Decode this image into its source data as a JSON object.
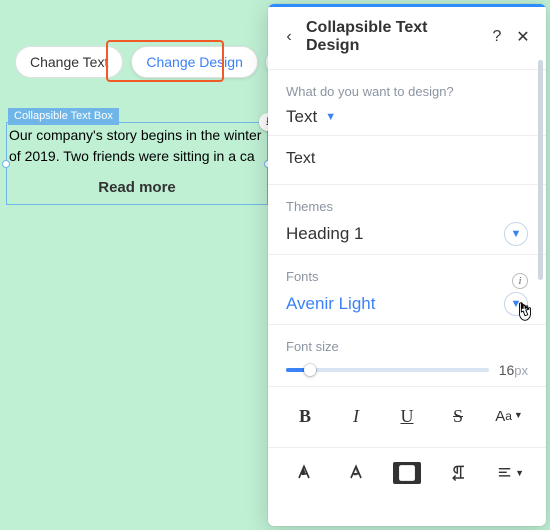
{
  "toolbar": {
    "change_text": "Change Text",
    "change_design": "Change Design"
  },
  "element": {
    "tag": "Collapsible Text Box",
    "body": "Our company's story begins in the winter of 2019. Two friends were sitting in a ca",
    "read_more": "Read more"
  },
  "panel": {
    "title": "Collapsible Text Design",
    "design_question": "What do you want to design?",
    "design_target": "Text",
    "subsection": "Text",
    "themes": {
      "label": "Themes",
      "value": "Heading 1"
    },
    "fonts": {
      "label": "Fonts",
      "value": "Avenir Light"
    },
    "font_size": {
      "label": "Font size",
      "value": "16",
      "unit": "px"
    },
    "case_label": "Aa"
  },
  "icons": {
    "back": "back-icon",
    "help": "help-icon",
    "close": "close-icon",
    "layout": "layout-icon",
    "download": "download-icon",
    "bold": "bold-icon",
    "italic": "italic-icon",
    "underline": "underline-icon",
    "strike": "strike-icon",
    "case": "text-case-icon",
    "text_color": "text-color-icon",
    "text_outline": "text-outline-icon",
    "highlight": "highlight-icon",
    "direction": "text-direction-icon",
    "align": "align-icon"
  },
  "colors": {
    "accent": "#3b82f6",
    "highlight_box": "#ef5a28",
    "bg": "#bff0d4"
  }
}
